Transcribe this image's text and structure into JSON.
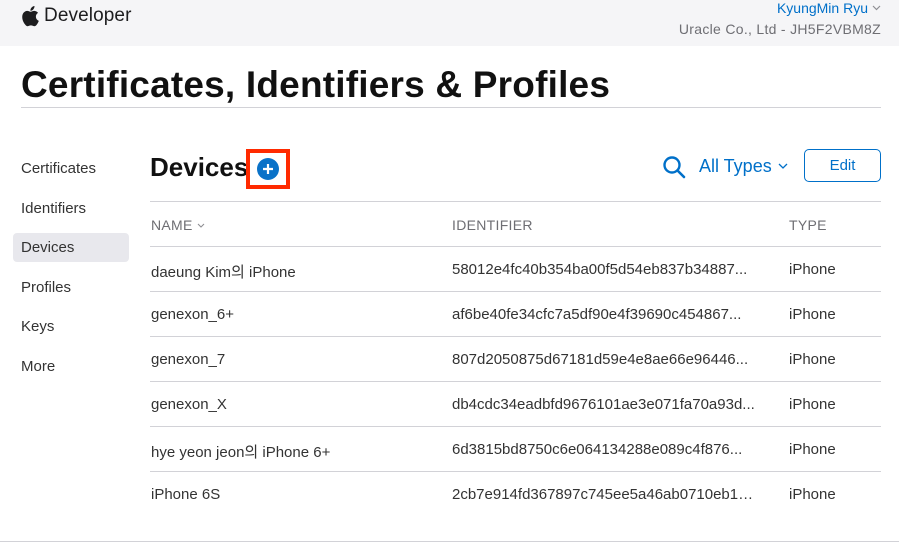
{
  "header": {
    "logo_text": "Developer",
    "user_name": "KyungMin Ryu",
    "team": "Uracle Co., Ltd - JH5F2VBM8Z"
  },
  "page_title": "Certificates, Identifiers & Profiles",
  "sidebar": {
    "items": [
      {
        "label": "Certificates"
      },
      {
        "label": "Identifiers"
      },
      {
        "label": "Devices",
        "active": true
      },
      {
        "label": "Profiles"
      },
      {
        "label": "Keys"
      },
      {
        "label": "More"
      }
    ]
  },
  "section": {
    "title": "Devices",
    "filter_label": "All Types",
    "edit_label": "Edit"
  },
  "table": {
    "headers": {
      "name": "NAME",
      "identifier": "IDENTIFIER",
      "type": "TYPE"
    },
    "rows": [
      {
        "name": "daeung Kim의 iPhone",
        "identifier": "58012e4fc40b354ba00f5d54eb837b34887...",
        "type": "iPhone"
      },
      {
        "name": "genexon_6+",
        "identifier": "af6be40fe34cfc7a5df90e4f39690c454867...",
        "type": "iPhone"
      },
      {
        "name": "genexon_7",
        "identifier": "807d2050875d67181d59e4e8ae66e96446...",
        "type": "iPhone"
      },
      {
        "name": "genexon_X",
        "identifier": "db4cdc34eadbfd9676101ae3e071fa70a93d...",
        "type": "iPhone"
      },
      {
        "name": "hye yeon jeon의 iPhone 6+",
        "identifier": "6d3815bd8750c6e064134288e089c4f876...",
        "type": "iPhone"
      },
      {
        "name": "iPhone 6S",
        "identifier": "2cb7e914fd367897c745ee5a46ab0710eb17...",
        "type": "iPhone"
      }
    ]
  },
  "colors": {
    "accent": "#0070c9",
    "add_icon": "#0a72c8",
    "highlight_box": "#ff2a00",
    "header_bg": "#f5f5f7",
    "active_sidebar_bg": "#e8e8ed"
  },
  "icons": {
    "logo": "apple-logo-icon",
    "add": "plus-circle-icon",
    "search": "search-icon",
    "dropdown": "chevron-down-icon"
  }
}
